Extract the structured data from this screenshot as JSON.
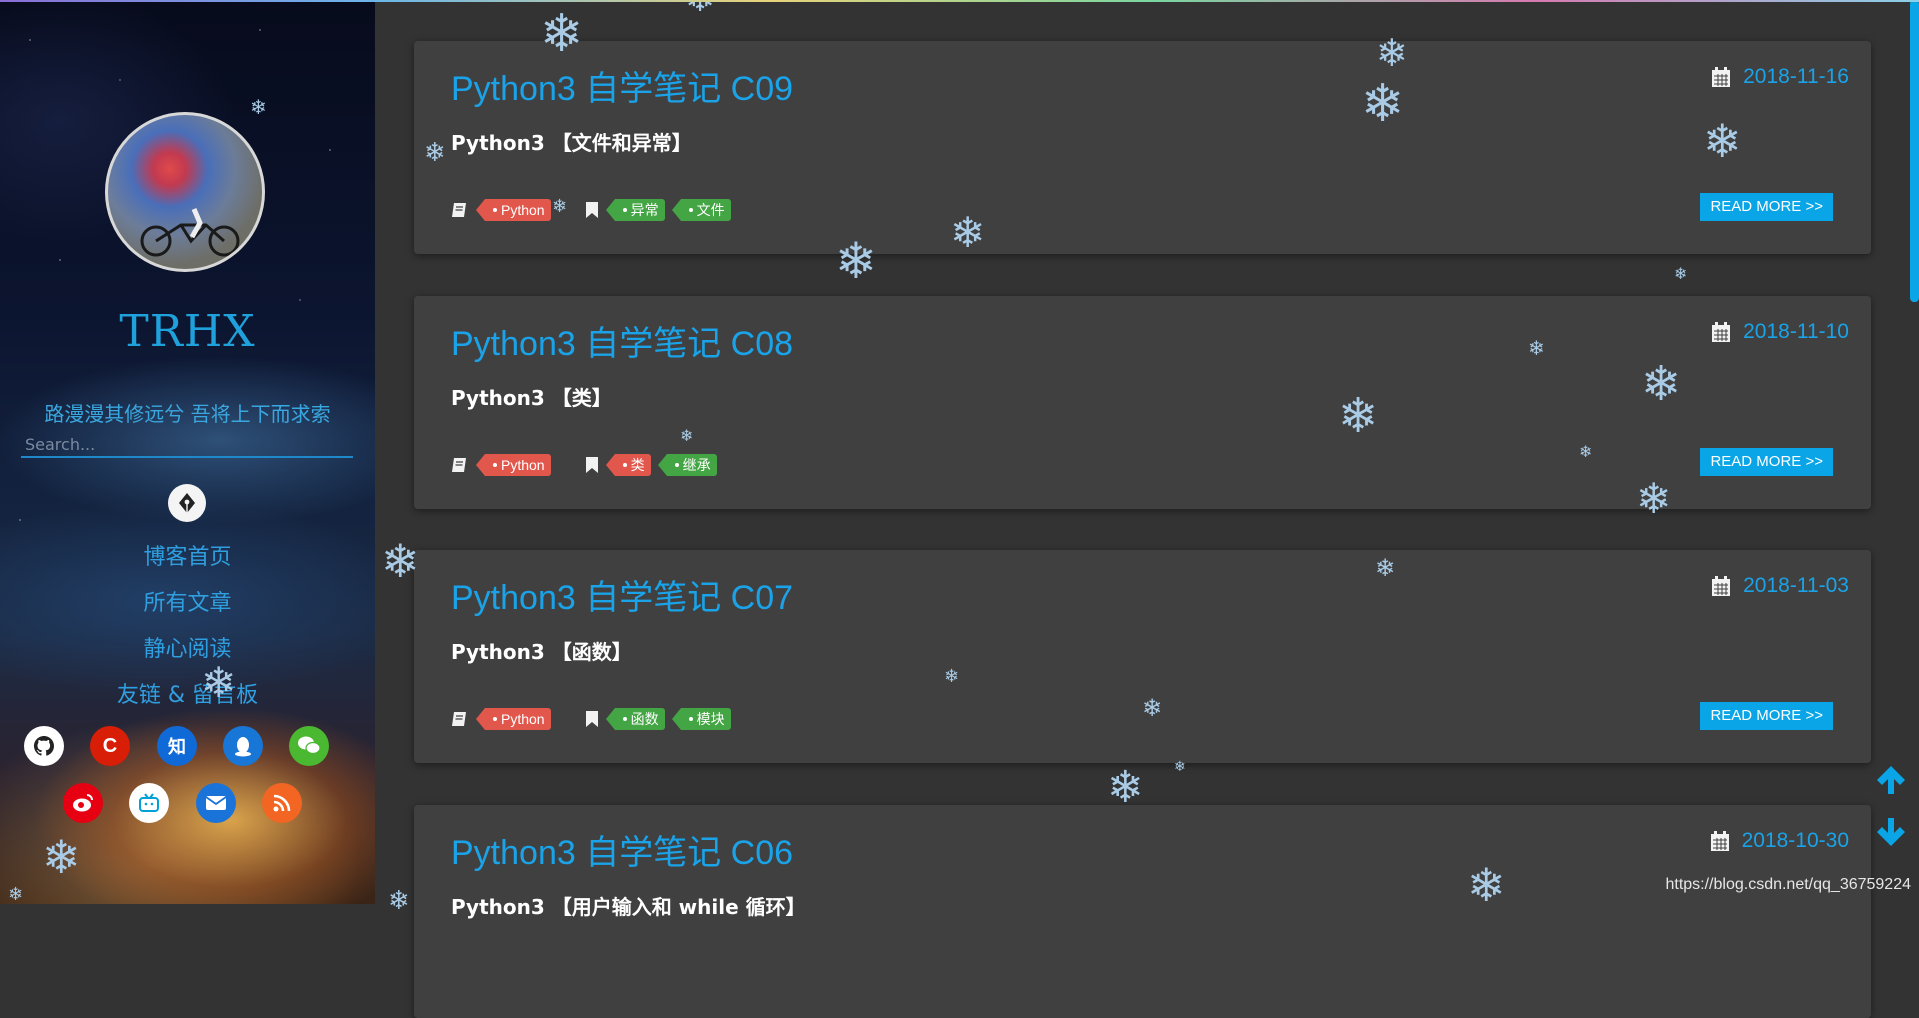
{
  "sidebar": {
    "blog_title": "TRHX",
    "motto": "路漫漫其修远兮 吾将上下而求索",
    "search": {
      "placeholder": "Search..."
    },
    "nav": [
      {
        "label": "博客首页"
      },
      {
        "label": "所有文章"
      },
      {
        "label": "静心阅读"
      },
      {
        "label": "友链 & 留言板"
      }
    ],
    "social": [
      {
        "icon": "github-icon",
        "label": "",
        "color": "#ffffff"
      },
      {
        "icon": "csdn-icon",
        "label": "C",
        "color": "#d81e06"
      },
      {
        "icon": "zhihu-icon",
        "label": "知",
        "color": "#0f6ad8"
      },
      {
        "icon": "qq-icon",
        "label": "",
        "color": "#1877d6"
      },
      {
        "icon": "wechat-icon",
        "label": "",
        "color": "#4ab830"
      },
      {
        "icon": "weibo-icon",
        "label": "",
        "color": "#e60012"
      },
      {
        "icon": "bilibili-icon",
        "label": "",
        "color": "#ffffff"
      },
      {
        "icon": "email-icon",
        "label": "",
        "color": "#1a73d8"
      },
      {
        "icon": "rss-icon",
        "label": "",
        "color": "#f26522"
      }
    ]
  },
  "posts": [
    {
      "title": "Python3 自学笔记 C09",
      "date": "2018-11-16",
      "subtitle": "Python3 【文件和异常】",
      "category": "Python",
      "tags": [
        "异常",
        "文件"
      ],
      "read_more": "READ MORE >>"
    },
    {
      "title": "Python3 自学笔记 C08",
      "date": "2018-11-10",
      "subtitle": "Python3 【类】",
      "category": "Python",
      "tags": [
        "类",
        "继承"
      ],
      "read_more": "READ MORE >>"
    },
    {
      "title": "Python3 自学笔记 C07",
      "date": "2018-11-03",
      "subtitle": "Python3 【函数】",
      "category": "Python",
      "tags": [
        "函数",
        "模块"
      ],
      "read_more": "READ MORE >>"
    },
    {
      "title": "Python3 自学笔记 C06",
      "date": "2018-10-30",
      "subtitle": "Python3 【用户输入和 while 循环】"
    }
  ],
  "watermark": "https://blog.csdn.net/qq_36759224",
  "colors": {
    "accent": "#1aa3e8",
    "card_bg": "#404040",
    "page_bg": "#333333",
    "category_tag": "#e2574c",
    "tag_green": "#44a544",
    "tag_red": "#e2574c",
    "read_more_bg": "#0aa5e6"
  }
}
